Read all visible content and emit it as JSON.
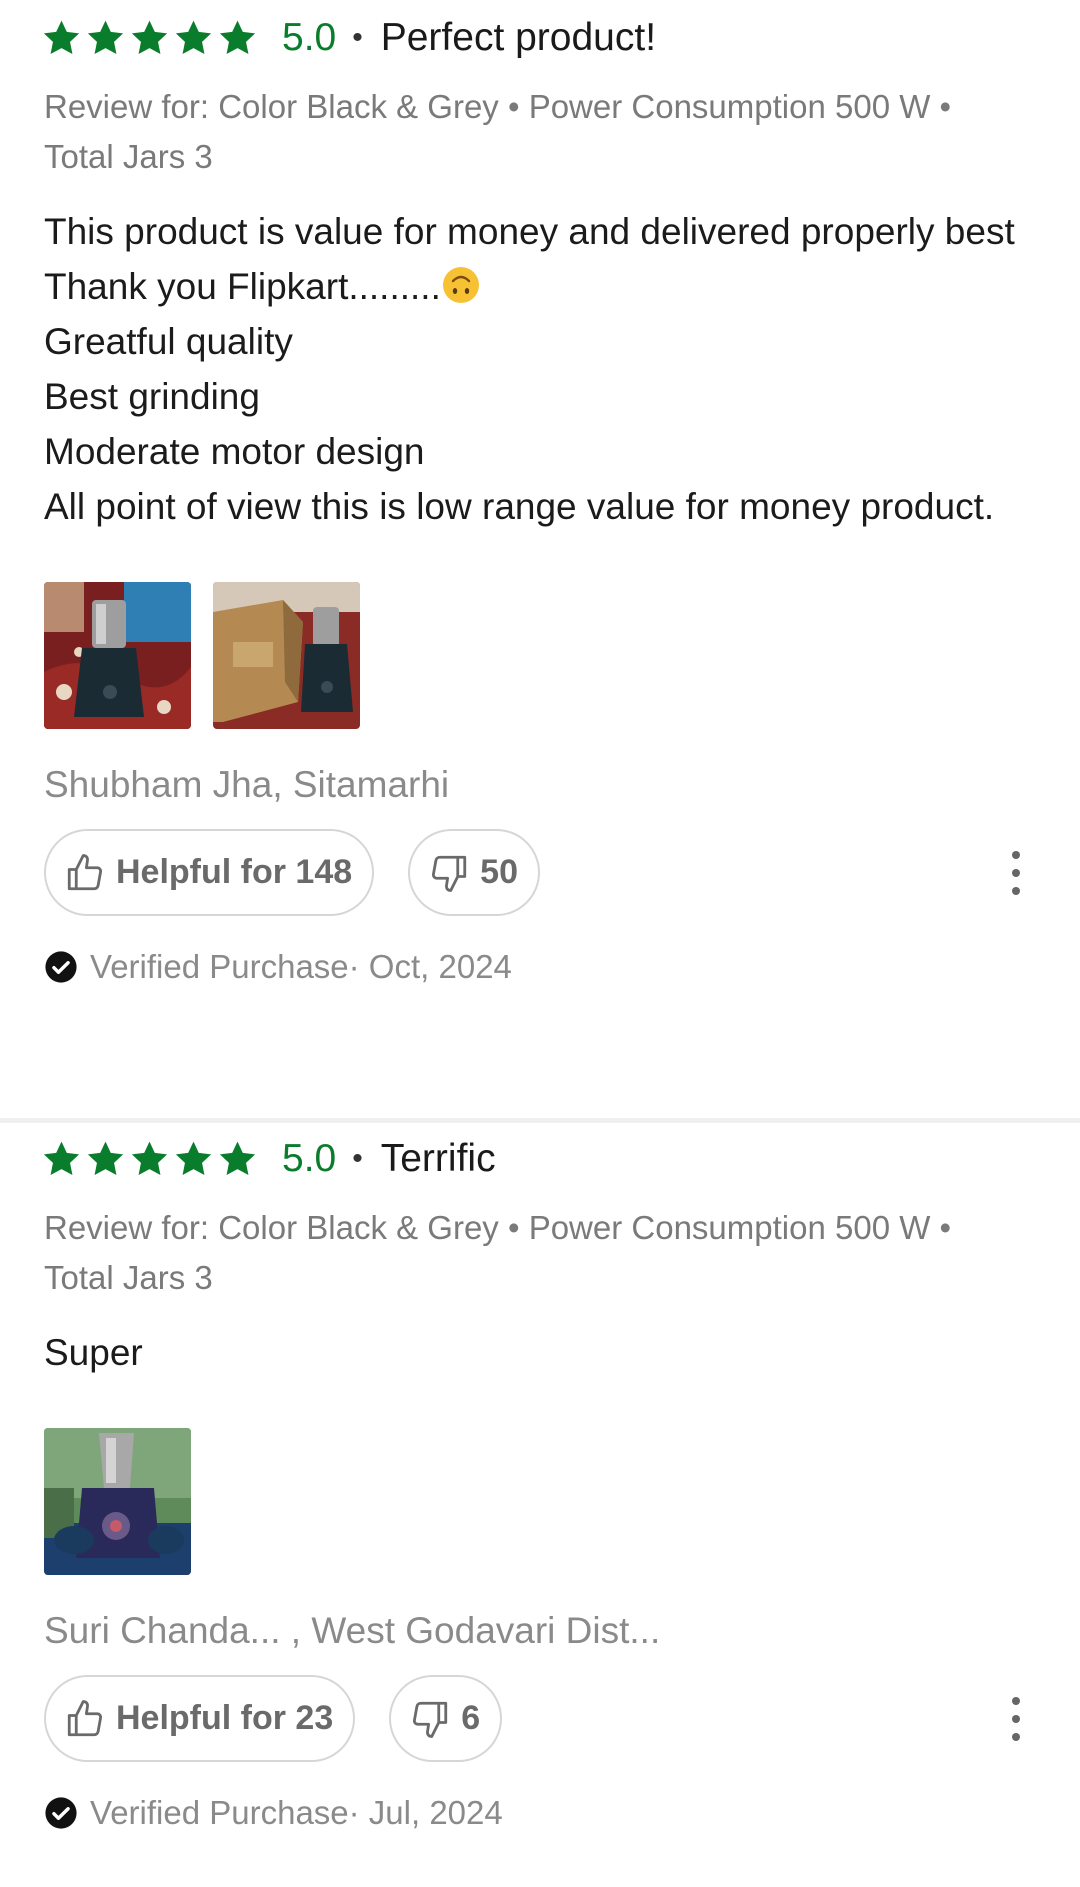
{
  "reviews": [
    {
      "rating": "5.0",
      "stars": 5,
      "star_color": "#0a7d2c",
      "separator": "•",
      "title": "Perfect product!",
      "variant": "Review for: Color Black & Grey • Power Consumption 500 W • Total Jars 3",
      "body": "This product is value for money and delivered properly best\nThank you Flipkart.........",
      "body_emoji": "upside-down-face-emoji",
      "body_rest": "\nGreatful quality\nBest grinding\nModerate motor design\nAll point of view this is low range value for money product.",
      "photos": [
        "mixer-grinder-photo",
        "mixer-grinder-box-photo"
      ],
      "reviewer": "Shubham Jha, Sitamarhi",
      "helpful_label": "Helpful for 148",
      "dislike_count": "50",
      "verified": "Verified Purchase· Oct, 2024"
    },
    {
      "rating": "5.0",
      "stars": 5,
      "star_color": "#0a7d2c",
      "separator": "•",
      "title": "Terrific",
      "variant": "Review for: Color Black & Grey • Power Consumption 500 W • Total Jars 3",
      "body": "Super",
      "photos": [
        "mixer-grinder-photo"
      ],
      "reviewer": "Suri Chanda... , West Godavari Dist...",
      "helpful_label": "Helpful for 23",
      "dislike_count": "6",
      "verified": "Verified Purchase· Jul, 2024"
    }
  ]
}
